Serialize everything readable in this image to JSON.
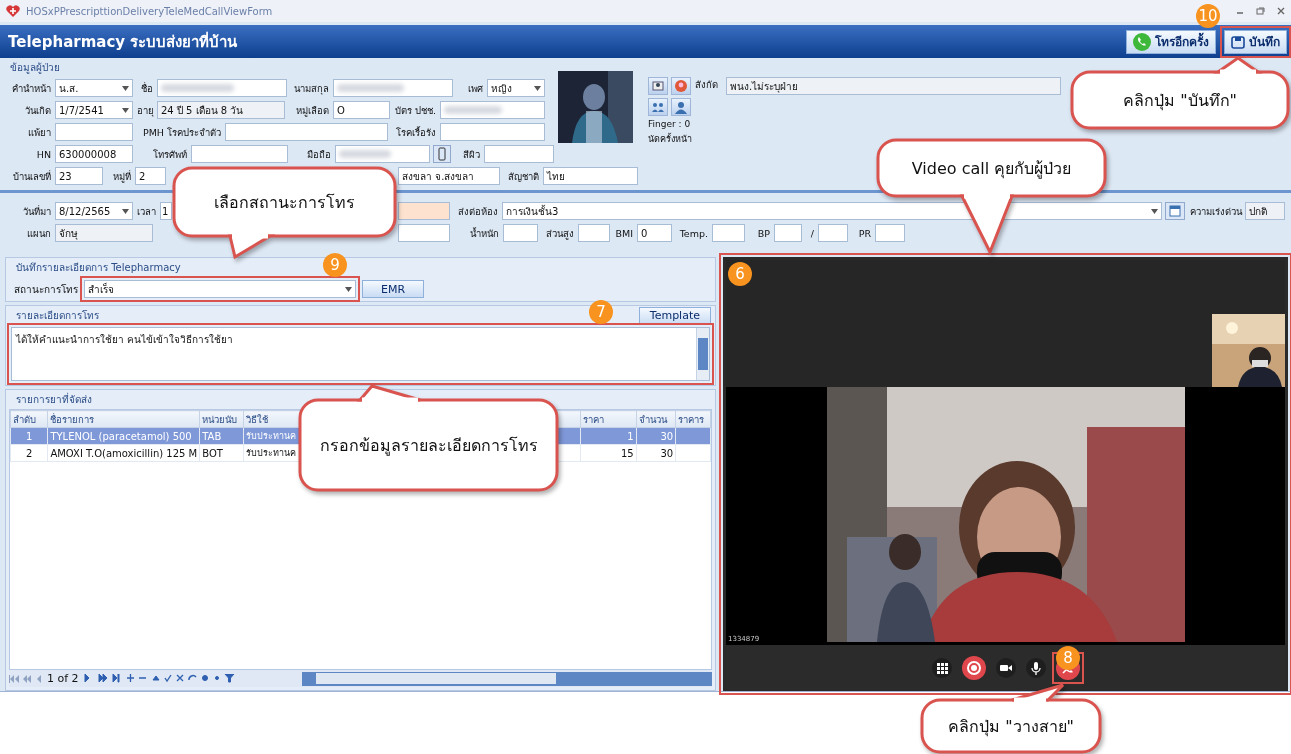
{
  "window": {
    "title": "HOSxPPrescripttionDeliveryTeleMedCallViewForm"
  },
  "header": {
    "title": "Telepharmacy ระบบส่งยาที่บ้าน",
    "buttons": [
      {
        "label": "โทรอีกครั้ง",
        "kind": "call"
      },
      {
        "label": "บันทึก",
        "kind": "save"
      }
    ]
  },
  "patient": {
    "section": "ข้อมูลผู้ป่วย",
    "rows": [
      [
        {
          "label": "คำนำหน้า",
          "value": "น.ส.",
          "kind": "dropdown"
        },
        {
          "label": "ชื่อ",
          "kind": "blurred"
        },
        {
          "label": "นามสกุล",
          "kind": "blurred"
        },
        {
          "label": "เพศ",
          "value": "หญิง",
          "kind": "dropdown"
        }
      ],
      [
        {
          "label": "วันเกิด",
          "value": "1/7/2541",
          "kind": "dropdown"
        },
        {
          "label": "อายุ",
          "value": "24 ปี 5 เดือน 8 วัน",
          "kind": "readonly"
        },
        {
          "label": "หมู่เลือด",
          "value": "O",
          "kind": "text"
        },
        {
          "label": "บัตร ปชช.",
          "kind": "blurred"
        }
      ],
      [
        {
          "label": "แพ้ยา",
          "kind": "text"
        },
        {
          "label": "PMH โรคประจำตัว",
          "kind": "text"
        },
        {
          "label": "โรคเรื้อรัง",
          "kind": "text"
        }
      ],
      [
        {
          "label": "HN",
          "value": "630000008",
          "kind": "text"
        },
        {
          "label": "โทรศัพท์",
          "kind": "text"
        },
        {
          "label": "มือถือ",
          "kind": "blurred"
        },
        {
          "label": "สีผิว",
          "kind": "text"
        }
      ],
      [
        {
          "label": "บ้านเลขที่",
          "value": "23",
          "kind": "text"
        },
        {
          "label": "หมู่ที่",
          "value": "2",
          "kind": "text"
        },
        {
          "value": "สงขลา จ.สงขลา",
          "kind": "text"
        },
        {
          "label": "สัญชาติ",
          "value": "ไทย",
          "kind": "text"
        }
      ]
    ],
    "affiliation": {
      "label": "สังกัด",
      "value": "พนง.ไม่ระบุฝ่าย"
    },
    "finger": "Finger : 0",
    "next_appointment": "นัดครั้งหน้า"
  },
  "visit": {
    "rows": [
      [
        {
          "label": "วันที่มา",
          "value": "8/12/2565",
          "kind": "dropdown"
        },
        {
          "label": "เวลา",
          "value": "1",
          "kind": "text"
        },
        {
          "kind": "highlighted"
        },
        {
          "label": "ส่งต่อห้อง",
          "value": "การเงินชั้น3",
          "kind": "dropdown"
        },
        {
          "label": "ความเร่งด่วน",
          "value": "ปกติ",
          "kind": "readonly"
        }
      ],
      [
        {
          "label": "แผนก",
          "value": "จักษุ",
          "kind": "readonly"
        },
        {
          "kind": "text"
        },
        {
          "label": "น้ำหนัก",
          "kind": "text"
        },
        {
          "label": "ส่วนสูง",
          "kind": "text"
        },
        {
          "label": "BMI",
          "value": "0",
          "kind": "text"
        },
        {
          "label": "Temp.",
          "kind": "text"
        },
        {
          "label": "BP",
          "kind": "text"
        },
        {
          "label": "/",
          "kind": "text"
        },
        {
          "label": "PR",
          "kind": "text"
        }
      ]
    ]
  },
  "call_record": {
    "section": "บันทึกรายละเอียดการ Telepharmacy",
    "status_label": "สถานะการโทร",
    "status": "สำเร็จ",
    "emr_button": "EMR",
    "details_label": "รายละเอียดการโทร",
    "template_button": "Template",
    "details": "ได้ให้คำแนะนำการใช้ยา คนไข้เข้าใจวิธีการใช้ยา"
  },
  "drugs": {
    "section": "รายการยาที่จัดส่ง",
    "columns": [
      "ลำดับ",
      "ชื่อรายการ",
      "หน่วยนับ",
      "วิธีใช้",
      "ราคา",
      "จำนวน",
      "ราคาร"
    ],
    "rows": [
      {
        "cells": [
          "1",
          "TYLENOL (paracetamol) 500",
          "TAB",
          "รับประทานค",
          "1",
          "30",
          ""
        ],
        "selected": true
      },
      {
        "cells": [
          "2",
          "AMOXI T.O(amoxicillin) 125 M",
          "BOT",
          "รับประทานค",
          "15",
          "30",
          ""
        ],
        "selected": false
      }
    ],
    "pager": "1 of 2"
  },
  "video": {
    "caller_id": "1334879"
  },
  "steps": [
    {
      "number": "10"
    },
    {
      "number": "6"
    },
    {
      "number": "9"
    },
    {
      "number": "7"
    },
    {
      "number": "8"
    }
  ],
  "callouts": [
    {
      "text": "คลิกปุ่ม \"บันทึก\""
    },
    {
      "text": "Video call คุยกับผู้ป่วย"
    },
    {
      "text": "เลือกสถานะการโทร"
    },
    {
      "text": "กรอกข้อมูลรายละเอียดการโทร"
    },
    {
      "text": "คลิกปุ่ม \"วางสาย\""
    }
  ]
}
